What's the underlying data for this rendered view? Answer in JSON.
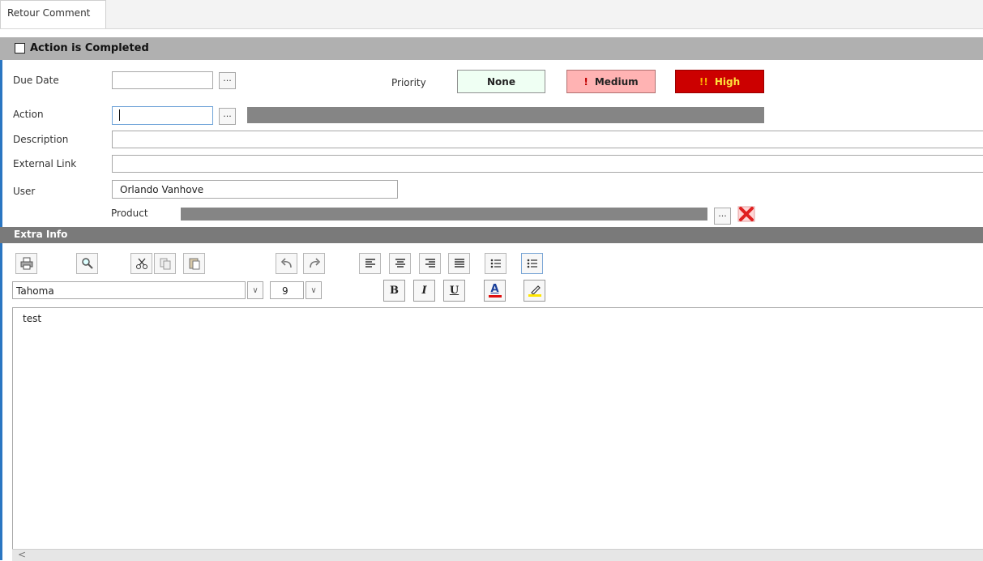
{
  "tab": {
    "label": "Retour Comment"
  },
  "header": {
    "completed_label": "Action is Completed",
    "completed_checked": false
  },
  "fields": {
    "due_date_label": "Due Date",
    "action_label": "Action",
    "description_label": "Description",
    "external_link_label": "External Link",
    "user_label": "User",
    "user_value": "Orlando Vanhove",
    "product_label": "Product",
    "ellipsis": "..."
  },
  "priority": {
    "label": "Priority",
    "options": [
      "None",
      "Medium",
      "High"
    ],
    "colors": {
      "none": "#effff3",
      "medium": "#ffb3b3",
      "high": "#cc0000"
    }
  },
  "extra": {
    "title": "Extra Info"
  },
  "toolbar": {
    "font_name": "Tahoma",
    "font_size": "9",
    "bold": "B",
    "italic": "I",
    "underline": "U",
    "color_letter": "A"
  },
  "editor": {
    "content": "test"
  },
  "scroll": {
    "left_arrow": "<"
  },
  "colors": {
    "accent": "#2a76c2",
    "strip": "#b0b0b0",
    "extra_strip": "#7a7a7a"
  }
}
